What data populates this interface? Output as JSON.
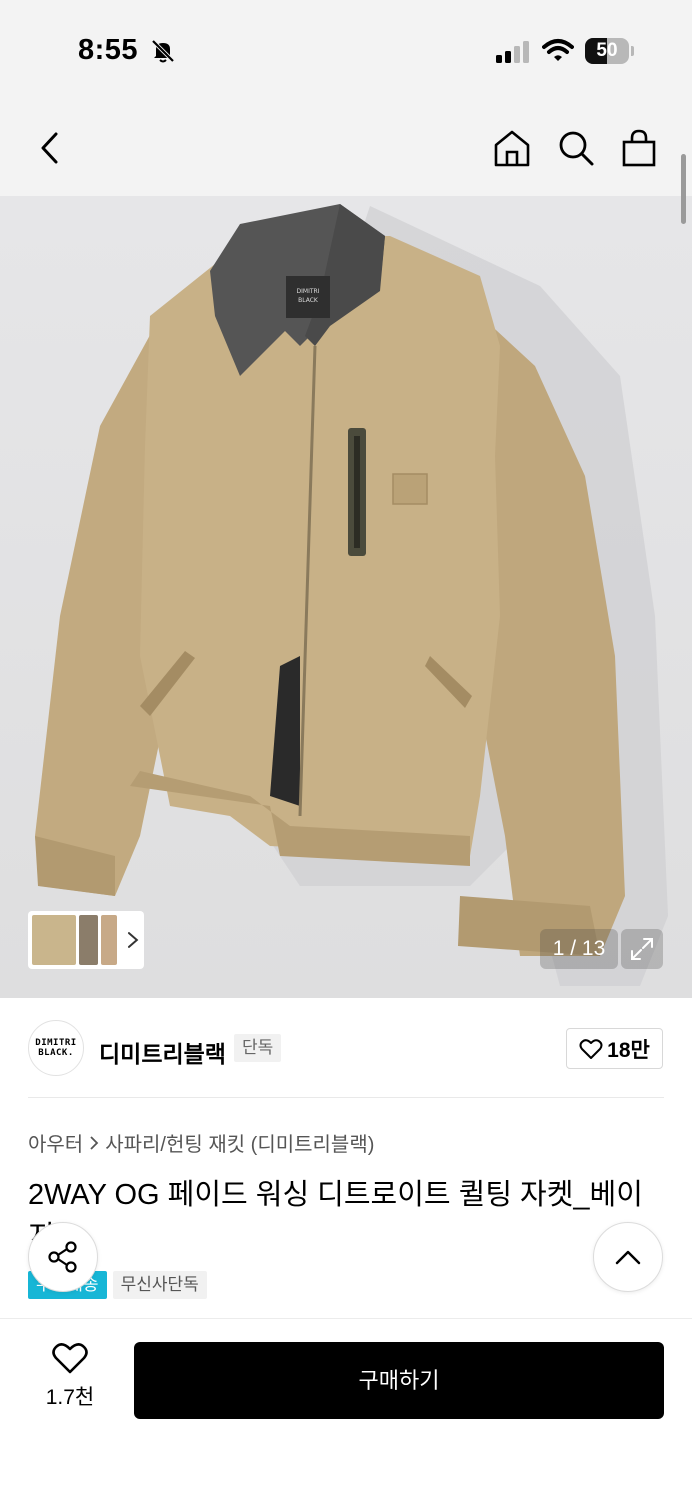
{
  "status_bar": {
    "time": "8:55",
    "battery": "50",
    "battery_level": 0.5
  },
  "nav": {
    "back": "chevron-left-icon",
    "home": "home-icon",
    "search": "search-icon",
    "bag": "shopping-bag-icon"
  },
  "gallery": {
    "counter": "1 / 13",
    "current": 1,
    "total": 13,
    "expand": "expand-icon"
  },
  "brand": {
    "logo_line1": "DIMITRI",
    "logo_line2": "BLACK.",
    "name": "디미트리블랙",
    "badge": "단독",
    "likes": "18만"
  },
  "product": {
    "breadcrumb": [
      "아우터",
      "사파리/헌팅 재킷 (디미트리블랙)"
    ],
    "title": "2WAY OG 페이드 워싱 디트로이트 퀼팅 자켓_베이지",
    "tags": [
      "무료배송",
      "무신사단독"
    ]
  },
  "bottom": {
    "wish_count": "1.7천",
    "buy_label": "구매하기"
  },
  "colors": {
    "accent": "#17b6d6",
    "buy_button": "#000000",
    "jacket": "#c4ad84",
    "collar": "#4f4f4f"
  }
}
